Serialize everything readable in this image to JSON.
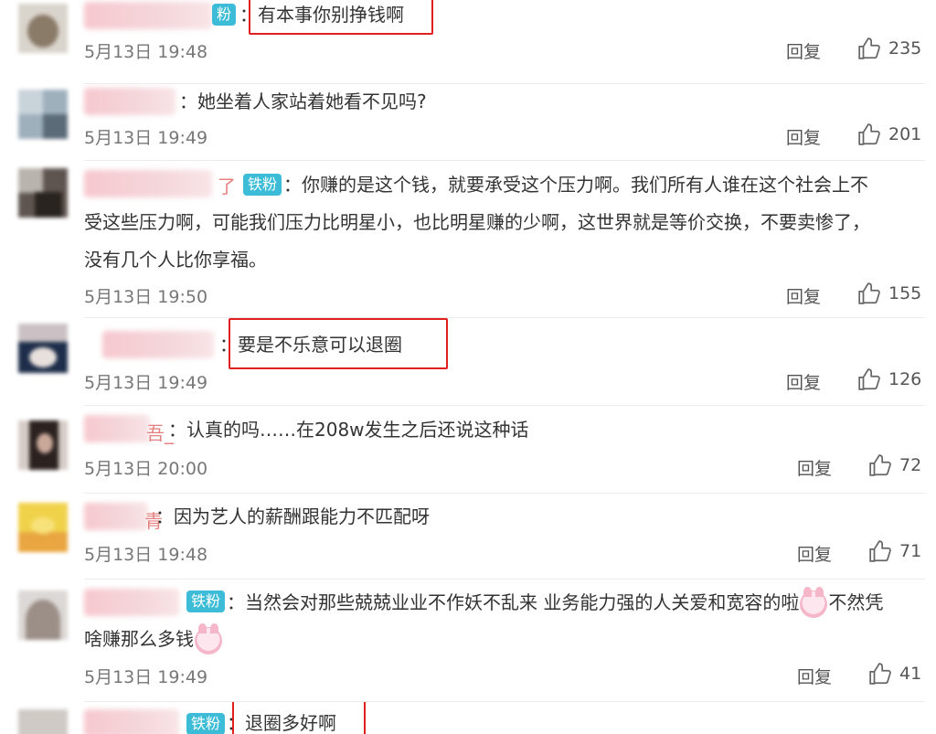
{
  "comments": [
    {
      "suffix": "",
      "badge": "粉",
      "text_lines": [
        "有本事你别挣钱啊"
      ],
      "date": "5月13日 19:48",
      "reply": "回复",
      "likes": "235"
    },
    {
      "suffix": "",
      "badge": "",
      "text_lines": [
        "她坐着人家站着她看不见吗?"
      ],
      "date": "5月13日 19:49",
      "reply": "回复",
      "likes": "201"
    },
    {
      "suffix": "了",
      "badge": "铁粉",
      "text_lines": [
        "你赚的是这个钱，就要承受这个压力啊。我们所有人谁在这个社会上不",
        "受这些压力啊，可能我们压力比明星小，也比明星赚的少啊，这世界就是等价交换，不要卖惨了，",
        "没有几个人比你享福。"
      ],
      "date": "5月13日 19:50",
      "reply": "回复",
      "likes": "155"
    },
    {
      "suffix": "",
      "badge": "",
      "text_lines": [
        "要是不乐意可以退圈"
      ],
      "date": "5月13日 19:49",
      "reply": "回复",
      "likes": "126"
    },
    {
      "suffix": "吾_",
      "badge": "",
      "text_lines": [
        "认真的吗……在208w发生之后还说这种话"
      ],
      "date": "5月13日 20:00",
      "reply": "回复",
      "likes": "72"
    },
    {
      "suffix": "青",
      "badge": "",
      "text_lines": [
        "因为艺人的薪酬跟能力不匹配呀"
      ],
      "date": "5月13日 19:48",
      "reply": "回复",
      "likes": "71"
    },
    {
      "suffix": "",
      "badge": "铁粉",
      "text_lines": [
        "当然会对那些兢兢业业不作妖不乱来 业务能力强的人关爱和宽容的啦",
        "不然凭",
        "啥赚那么多钱"
      ],
      "date": "5月13日 19:49",
      "reply": "回复",
      "likes": "41"
    },
    {
      "suffix": "",
      "badge": "铁粉",
      "text_lines": [
        "退圈多好啊"
      ],
      "date": "",
      "reply": "",
      "likes": ""
    }
  ],
  "icons": {
    "like": "thumbs-up-icon",
    "emoji": "pink-bunny-emoji-icon"
  },
  "colors": {
    "badge": "#3cbcd6",
    "highlight_box": "#e02020",
    "suffix": "#e67f7f"
  }
}
